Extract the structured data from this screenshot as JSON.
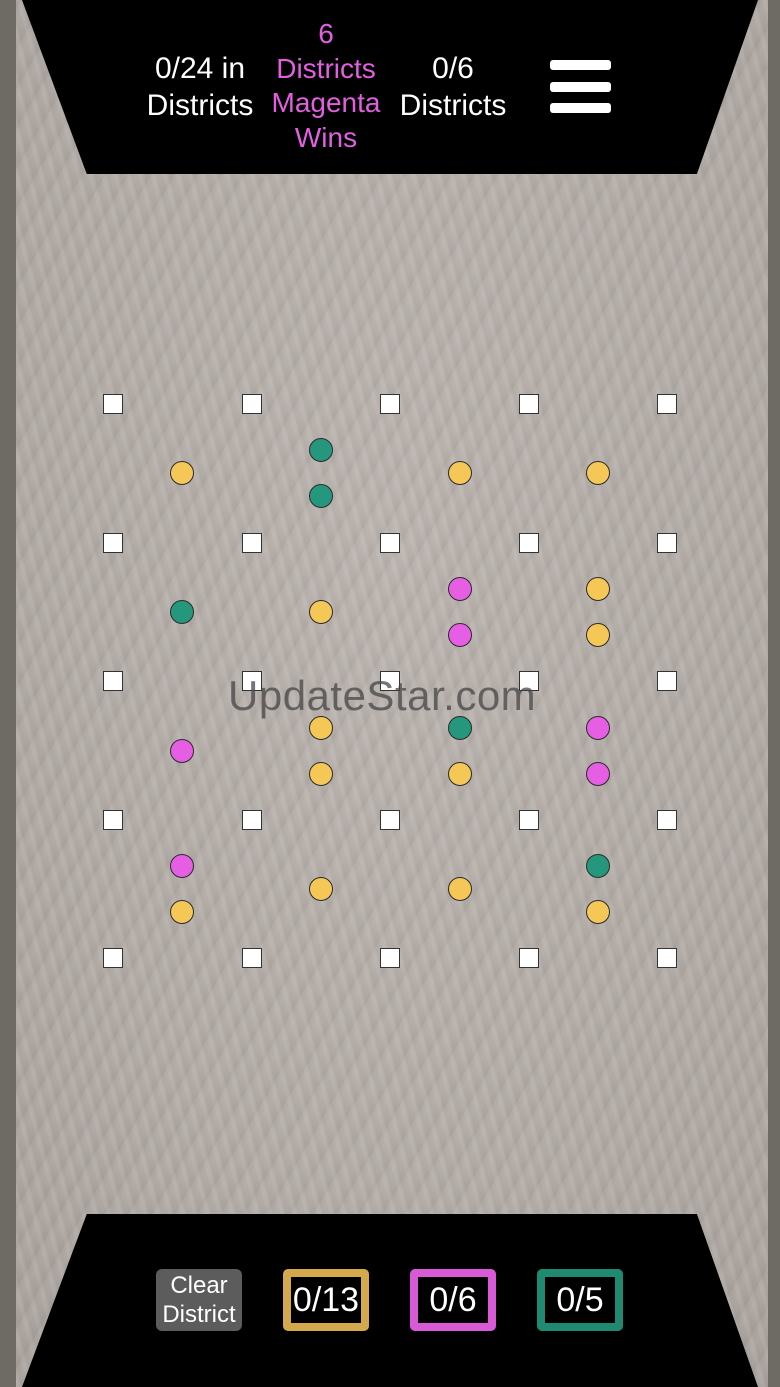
{
  "header": {
    "left_stat": [
      "0/24 in",
      "Districts"
    ],
    "center_stat": [
      "6",
      "Districts",
      "Magenta",
      "Wins"
    ],
    "right_stat": [
      "0/6",
      "Districts"
    ],
    "center_color": "#e060e0",
    "menu_icon": "hamburger-menu-icon"
  },
  "board": {
    "rows": 5,
    "cols": 5,
    "voters": [
      {
        "col": 0,
        "row": 0,
        "colors": [
          "yellow"
        ]
      },
      {
        "col": 1,
        "row": 0,
        "colors": [
          "teal",
          "teal"
        ]
      },
      {
        "col": 2,
        "row": 0,
        "colors": [
          "yellow"
        ]
      },
      {
        "col": 3,
        "row": 0,
        "colors": [
          "yellow"
        ]
      },
      {
        "col": 0,
        "row": 1,
        "colors": [
          "teal"
        ]
      },
      {
        "col": 1,
        "row": 1,
        "colors": [
          "yellow"
        ]
      },
      {
        "col": 2,
        "row": 1,
        "colors": [
          "magenta",
          "magenta"
        ]
      },
      {
        "col": 3,
        "row": 1,
        "colors": [
          "yellow",
          "yellow"
        ]
      },
      {
        "col": 0,
        "row": 2,
        "colors": [
          "magenta"
        ]
      },
      {
        "col": 1,
        "row": 2,
        "colors": [
          "yellow",
          "yellow"
        ]
      },
      {
        "col": 2,
        "row": 2,
        "colors": [
          "teal",
          "yellow"
        ]
      },
      {
        "col": 3,
        "row": 2,
        "colors": [
          "magenta",
          "magenta"
        ]
      },
      {
        "col": 0,
        "row": 3,
        "colors": [
          "magenta",
          "yellow"
        ]
      },
      {
        "col": 1,
        "row": 3,
        "colors": [
          "yellow"
        ]
      },
      {
        "col": 2,
        "row": 3,
        "colors": [
          "yellow"
        ]
      },
      {
        "col": 3,
        "row": 3,
        "colors": [
          "teal",
          "yellow"
        ]
      }
    ],
    "colors": {
      "yellow": "#f5c757",
      "magenta": "#e65ee3",
      "teal": "#24977d"
    }
  },
  "watermark": "UpdateStar.com",
  "footer": {
    "clear_label": [
      "Clear",
      "District"
    ],
    "counts": [
      {
        "label": "0/13",
        "color": "#d4a84c"
      },
      {
        "label": "0/6",
        "color": "#d85ad6"
      },
      {
        "label": "0/5",
        "color": "#1f8a6f"
      }
    ]
  }
}
